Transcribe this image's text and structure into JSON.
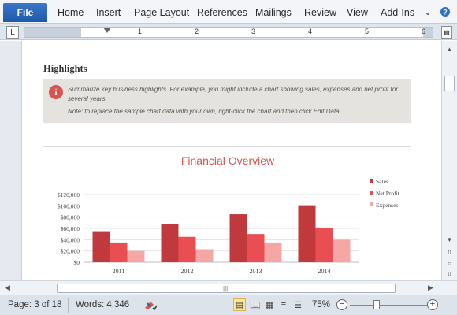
{
  "ribbon": {
    "file_label": "File",
    "tabs": [
      "Home",
      "Insert",
      "Page Layout",
      "References",
      "Mailings",
      "Review",
      "View",
      "Add-Ins"
    ]
  },
  "ruler": {
    "tab_selector": "L",
    "numbers": [
      "1",
      "2",
      "3",
      "4",
      "5",
      "6"
    ]
  },
  "document": {
    "heading": "Highlights",
    "callout_text": "Summarize key business highlights. For example, you might include a chart showing sales, expenses and net profit for several years.",
    "callout_note": "Note: to replace the sample chart data with your own, right-click the chart and then click Edit Data."
  },
  "chart_data": {
    "type": "bar",
    "title": "Financial Overview",
    "categories": [
      "2011",
      "2012",
      "2013",
      "2014"
    ],
    "series": [
      {
        "name": "Sales",
        "color": "#c0393d",
        "values": [
          55000,
          68000,
          85000,
          101000
        ]
      },
      {
        "name": "Net Profit",
        "color": "#e94e52",
        "values": [
          35000,
          45000,
          50000,
          60000
        ]
      },
      {
        "name": "Expenses",
        "color": "#f4a7a4",
        "values": [
          20000,
          23000,
          35000,
          40000
        ]
      }
    ],
    "yticks": [
      "$0",
      "$20,000",
      "$40,000",
      "$60,000",
      "$80,000",
      "$100,000",
      "$120,000"
    ],
    "ylim": [
      0,
      120000
    ],
    "grid": true,
    "legend": "right"
  },
  "status": {
    "page": "Page: 3 of 18",
    "words": "Words: 4,346",
    "zoom": "75%"
  },
  "colors": {
    "accent": "#2b5fb4",
    "title": "#d9534f"
  }
}
